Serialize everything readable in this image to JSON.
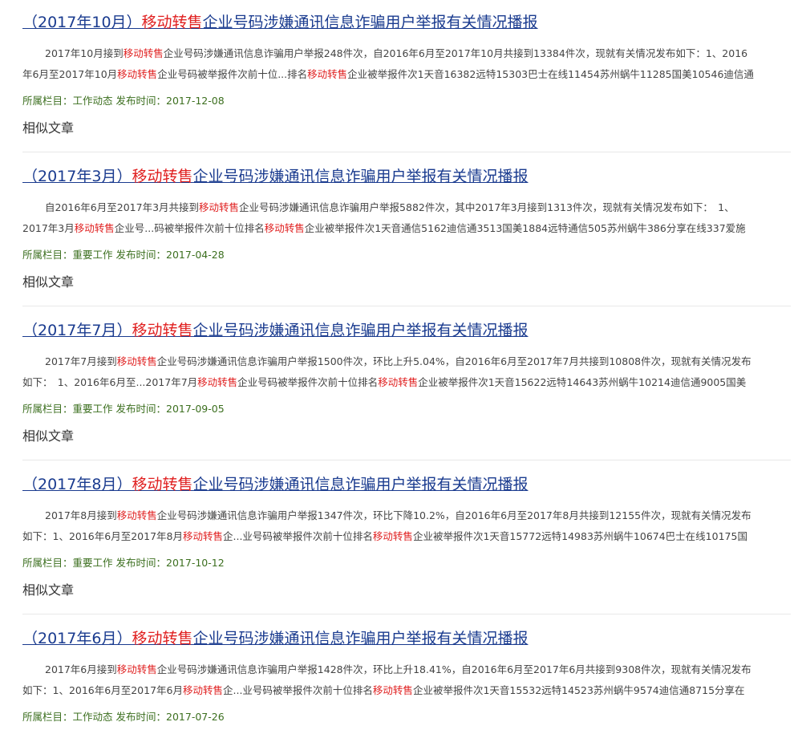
{
  "labels": {
    "category": "所属栏目：",
    "date": "发布时间：",
    "similar": "相似文章"
  },
  "highlight_color": "#e02020",
  "title_color": "#1a3b8f",
  "articles": [
    {
      "title": [
        {
          "text": "（2017年10月）"
        },
        {
          "text": "移动转售",
          "hl": true
        },
        {
          "text": "企业号码涉嫌通讯信息诈骗用户举报有关情况播报"
        }
      ],
      "summary_lines": [
        [
          {
            "text": "2017年10月接到"
          },
          {
            "text": "移动转售",
            "hl": true
          },
          {
            "text": "企业号码涉嫌通讯信息诈骗用户举报248件次，自2016年6月至2017年10月共接到13384件次，现就有关情况发布如下：1、2016"
          }
        ],
        [
          {
            "text": "年6月至2017年10月"
          },
          {
            "text": "移动转售",
            "hl": true
          },
          {
            "text": "企业号码被举报件次前十位...排名"
          },
          {
            "text": "移动转售",
            "hl": true
          },
          {
            "text": "企业被举报件次1天音16382远特15303巴士在线11454苏州蜗牛11285国美10546迪信通"
          }
        ]
      ],
      "category": "工作动态",
      "date": "2017-12-08",
      "show_similar": true
    },
    {
      "title": [
        {
          "text": "（2017年3月）"
        },
        {
          "text": "移动转售",
          "hl": true
        },
        {
          "text": "企业号码涉嫌通讯信息诈骗用户举报有关情况播报"
        }
      ],
      "summary_lines": [
        [
          {
            "text": "自2016年6月至2017年3月共接到"
          },
          {
            "text": "移动转售",
            "hl": true
          },
          {
            "text": "企业号码涉嫌通讯信息诈骗用户举报5882件次，其中2017年3月接到1313件次，现就有关情况发布如下：　1、"
          }
        ],
        [
          {
            "text": "2017年3月"
          },
          {
            "text": "移动转售",
            "hl": true
          },
          {
            "text": "企业号...码被举报件次前十位排名"
          },
          {
            "text": "移动转售",
            "hl": true
          },
          {
            "text": "企业被举报件次1天音通信5162迪信通3513国美1884远特通信505苏州蜗牛386分享在线337爱施"
          }
        ]
      ],
      "category": "重要工作",
      "date": "2017-04-28",
      "show_similar": true
    },
    {
      "title": [
        {
          "text": "（2017年7月）"
        },
        {
          "text": "移动转售",
          "hl": true
        },
        {
          "text": "企业号码涉嫌通讯信息诈骗用户举报有关情况播报"
        }
      ],
      "summary_lines": [
        [
          {
            "text": "2017年7月接到"
          },
          {
            "text": "移动转售",
            "hl": true
          },
          {
            "text": "企业号码涉嫌通讯信息诈骗用户举报1500件次，环比上升5.04%，自2016年6月至2017年7月共接到10808件次，现就有关情况发布"
          }
        ],
        [
          {
            "text": "如下：　1、2016年6月至...2017年7月"
          },
          {
            "text": "移动转售",
            "hl": true
          },
          {
            "text": "企业号码被举报件次前十位排名"
          },
          {
            "text": "移动转售",
            "hl": true
          },
          {
            "text": "企业被举报件次1天音15622远特14643苏州蜗牛10214迪信通9005国美"
          }
        ]
      ],
      "category": "重要工作",
      "date": "2017-09-05",
      "show_similar": true
    },
    {
      "title": [
        {
          "text": "（2017年8月）"
        },
        {
          "text": "移动转售",
          "hl": true
        },
        {
          "text": "企业号码涉嫌通讯信息诈骗用户举报有关情况播报"
        }
      ],
      "summary_lines": [
        [
          {
            "text": "2017年8月接到"
          },
          {
            "text": "移动转售",
            "hl": true
          },
          {
            "text": "企业号码涉嫌通讯信息诈骗用户举报1347件次，环比下降10.2%，自2016年6月至2017年8月共接到12155件次，现就有关情况发布"
          }
        ],
        [
          {
            "text": "如下：1、2016年6月至2017年8月"
          },
          {
            "text": "移动转售",
            "hl": true
          },
          {
            "text": "企...业号码被举报件次前十位排名"
          },
          {
            "text": "移动转售",
            "hl": true
          },
          {
            "text": "企业被举报件次1天音15772远特14983苏州蜗牛10674巴士在线10175国"
          }
        ]
      ],
      "category": "重要工作",
      "date": "2017-10-12",
      "show_similar": true
    },
    {
      "title": [
        {
          "text": "（2017年6月）"
        },
        {
          "text": "移动转售",
          "hl": true
        },
        {
          "text": "企业号码涉嫌通讯信息诈骗用户举报有关情况播报"
        }
      ],
      "summary_lines": [
        [
          {
            "text": "2017年6月接到"
          },
          {
            "text": "移动转售",
            "hl": true
          },
          {
            "text": "企业号码涉嫌通讯信息诈骗用户举报1428件次，环比上升18.41%，自2016年6月至2017年6月共接到9308件次，现就有关情况发布"
          }
        ],
        [
          {
            "text": "如下：1、2016年6月至2017年6月"
          },
          {
            "text": "移动转售",
            "hl": true
          },
          {
            "text": "企...业号码被举报件次前十位排名"
          },
          {
            "text": "移动转售",
            "hl": true
          },
          {
            "text": "企业被举报件次1天音15532远特14523苏州蜗牛9574迪信通8715分享在"
          }
        ]
      ],
      "category": "工作动态",
      "date": "2017-07-26",
      "show_similar": false
    }
  ]
}
